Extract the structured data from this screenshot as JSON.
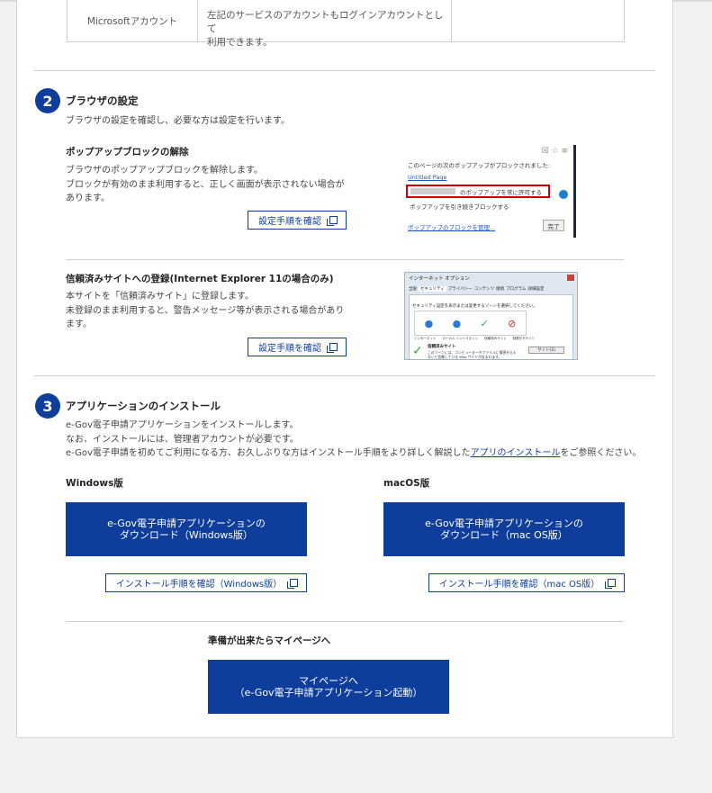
{
  "table": {
    "row_label": "Microsoftアカウント",
    "row_desc_line1": "左記のサービスのアカウントもログインアカウントとして",
    "row_desc_line2": "利用できます。"
  },
  "section2": {
    "number": "2",
    "title": "ブラウザの設定",
    "desc": "ブラウザの設定を確認し、必要な方は設定を行います。",
    "popup": {
      "title": "ポップアップブロックの解除",
      "line1": "ブラウザのポップアップブロックを解除します。",
      "line2": "ブロックが有効のまま利用すると、正しく画面が表示されない場合が",
      "line3": "あります。",
      "button": "設定手順を確認"
    },
    "trusted": {
      "title": "信頼済みサイトへの登録(Internet Explorer 11の場合のみ)",
      "line1": "本サイトを「信頼済みサイト」に登録します。",
      "line2": "未登録のまま利用すると、警告メッセージ等が表示される場合があり",
      "line3": "ます。",
      "button": "設定手順を確認"
    },
    "popup_shot": {
      "header": "このページの次のポップアップがブロックされました:",
      "page": "Untitled Page",
      "allow": "のポップアップを常に許可する",
      "block": "ポップアップを引き続きブロックする",
      "manage": "ポップアップのブロックを管理...",
      "done": "完了"
    },
    "ie_shot": {
      "title": "インターネット オプション",
      "tabs": [
        "全般",
        "セキュリティ",
        "プライバシー",
        "コンテンツ",
        "接続",
        "プログラム",
        "詳細設定"
      ],
      "zone_note": "セキュリティ設定を表示または変更するゾーンを選択してください。",
      "zones": [
        "インターネット",
        "ローカル イントラネット",
        "信頼済みサイト",
        "制限付きサイト"
      ],
      "trusted_label": "信頼済みサイト",
      "trusted_desc": "このゾーンには、コンピューターやファイルに損害を与えないと信頼している Web サイトが含まれます。",
      "sites_button": "サイト(S)"
    }
  },
  "section3": {
    "number": "3",
    "title": "アプリケーションのインストール",
    "line1": "e-Gov電子申請アプリケーションをインストールします。",
    "line2": "なお、インストールには、管理者アカウントが必要です。",
    "line3_pre": "e-Gov電子申請を初めてご利用になる方、お久しぶりな方はインストール手順をより詳しく解説した",
    "line3_link": "アプリのインストール",
    "line3_post": "をご参照ください。",
    "windows": {
      "label": "Windows版",
      "download": "e-Gov電子申請アプリケーションの\nダウンロード（Windows版）",
      "steps": "インストール手順を確認（Windows版）"
    },
    "mac": {
      "label": "macOS版",
      "download": "e-Gov電子申請アプリケーションの\nダウンロード（mac OS版）",
      "steps": "インストール手順を確認（mac OS版）"
    },
    "ready": "準備が出来たらマイページへ",
    "mypage": "マイページへ\n（e-Gov電子申請アプリケーション起動）"
  }
}
